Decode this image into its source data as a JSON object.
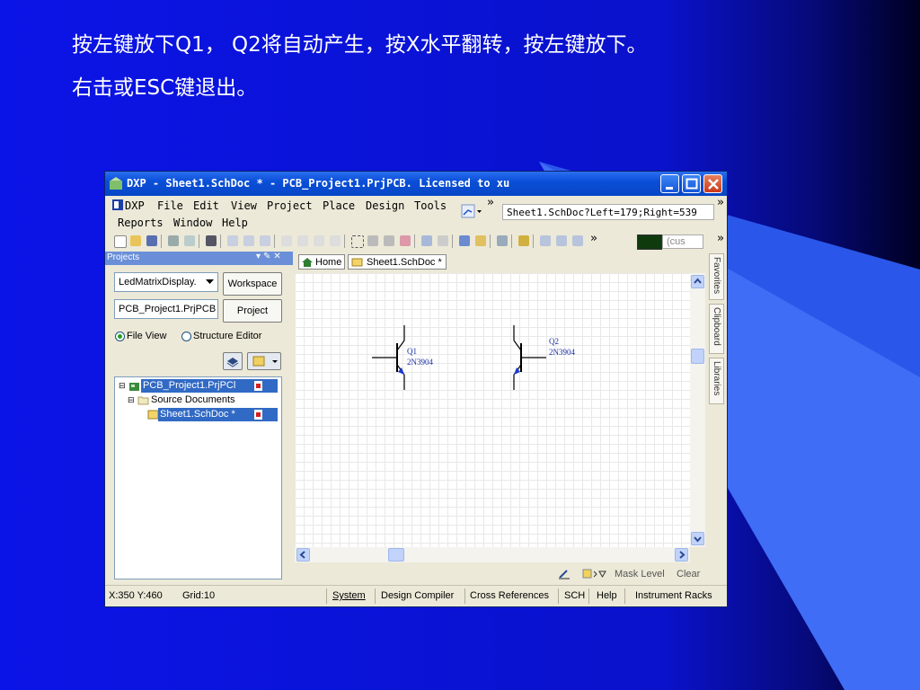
{
  "slide": {
    "line1": "按左键放下Q1， Q2将自动产生，按X水平翻转，按左键放下。",
    "line2": "右击或ESC键退出。",
    "colors": {
      "background": "#0b14e6",
      "accent_dark": "#000033",
      "accent_light": "#3f6df5"
    }
  },
  "window": {
    "title": "DXP - Sheet1.SchDoc * - PCB_Project1.PrjPCB. Licensed to xu",
    "menu": [
      "DXP",
      "File",
      "Edit",
      "View",
      "Project",
      "Place",
      "Design",
      "Tools",
      "Reports",
      "Window",
      "Help"
    ],
    "doc_path": "Sheet1.SchDoc?Left=179;Right=539",
    "color_combo": "(cus",
    "chevron": "»"
  },
  "projects_panel": {
    "title": "Projects",
    "workspace_combo": "LedMatrixDisplay.",
    "workspace_button": "Workspace",
    "project_field": "PCB_Project1.PrjPCB",
    "project_button": "Project",
    "view_modes": [
      "File View",
      "Structure Editor"
    ],
    "selected_view": "File View",
    "tree": {
      "project": "PCB_Project1.PrjPCl",
      "folder": "Source Documents",
      "document": "Sheet1.SchDoc *"
    }
  },
  "document": {
    "tabs": [
      "Home",
      "Sheet1.SchDoc *"
    ],
    "active_tab": "Sheet1.SchDoc *",
    "components": [
      {
        "designator": "Q1",
        "part": "2N3904"
      },
      {
        "designator": "Q2",
        "part": "2N3904"
      }
    ]
  },
  "side_tabs": [
    "Favorites",
    "Clipboard",
    "Libraries"
  ],
  "mask_bar": {
    "mask_label": "Mask Level",
    "clear_label": "Clear"
  },
  "status": {
    "coords": "X:350 Y:460",
    "grid": "Grid:10",
    "buttons": [
      "System",
      "Design Compiler",
      "Cross References",
      "SCH",
      "Help",
      "Instrument Racks"
    ]
  }
}
